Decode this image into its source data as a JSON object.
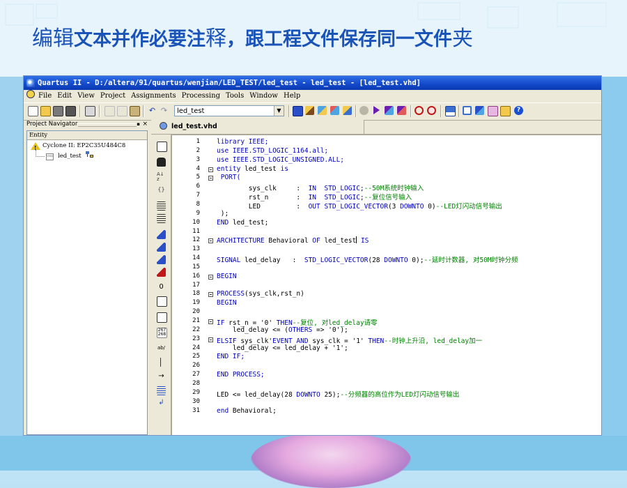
{
  "slide": {
    "title_parts": [
      {
        "text": "编辑",
        "style": "light"
      },
      {
        "text": "文本并作必要注",
        "style": "bold"
      },
      {
        "text": "释",
        "style": "light"
      },
      {
        "text": "，跟工程文件保存同一文件",
        "style": "bold"
      },
      {
        "text": "夹",
        "style": "light"
      }
    ],
    "title_color": "#1a54b8"
  },
  "window": {
    "title": "Quartus II - D:/altera/91/quartus/wenjian/LED_TEST/led_test - led_test - [led_test.vhd]",
    "titlebar_color": "#1248c8"
  },
  "menubar": {
    "items": [
      "File",
      "Edit",
      "View",
      "Project",
      "Assignments",
      "Processing",
      "Tools",
      "Window",
      "Help"
    ]
  },
  "toolbar": {
    "entity_value": "led_test",
    "icons": [
      "new-icon",
      "open-icon",
      "save-icon",
      "save-all-icon",
      "print-icon",
      "cut-icon",
      "copy-icon",
      "paste-icon",
      "undo-icon",
      "redo-icon",
      "pin-planner-icon",
      "assignment-editor-icon",
      "settings-icon",
      "chip-planner-icon",
      "design-partitions-icon",
      "stop-icon",
      "start-compilation-icon",
      "analysis-icon",
      "timing-icon",
      "fitter-icon",
      "timing-analyzer-icon",
      "simulator-icon",
      "programmer-icon",
      "rtl-viewer-icon",
      "chip-editor-icon",
      "help-icon"
    ]
  },
  "navigator": {
    "title": "Project Navigator",
    "column_header": "Entity",
    "device": "Cyclone II: EP2C35U484C8",
    "top_entity": "led_test"
  },
  "editor": {
    "tab_label": "led_test.vhd",
    "side_icons": [
      "insert-template-icon",
      "find-icon",
      "toggle-case-icon",
      "insert-block-icon",
      "indent-icon",
      "unindent-icon",
      "bookmark-toggle-icon",
      "bookmark-next-icon",
      "bookmark-prev-icon",
      "bookmark-clear-icon",
      "attach-icon",
      "template-icon",
      "compile-file-icon",
      "line-number-icon",
      "abc-icon",
      "line-icon",
      "goto-line-icon",
      "list-icon",
      "wrap-icon"
    ],
    "line_numbers": [
      "1",
      "2",
      "3",
      "4",
      "5",
      "6",
      "7",
      "8",
      "9",
      "10",
      "11",
      "12",
      "13",
      "14",
      "15",
      "16",
      "17",
      "18",
      "19",
      "20",
      "21",
      "22",
      "23",
      "24",
      "25",
      "26",
      "27",
      "28",
      "29",
      "30",
      "31"
    ],
    "fold_lines": [
      4,
      5,
      12,
      16,
      18,
      21,
      23
    ],
    "lines": [
      [
        {
          "t": "library IEEE;",
          "c": "kw"
        }
      ],
      [
        {
          "t": "use IEEE.STD_LOGIC_1164.all;",
          "c": "kw"
        }
      ],
      [
        {
          "t": "use IEEE.STD_LOGIC_UNSIGNED.ALL;",
          "c": "kw"
        }
      ],
      [
        {
          "t": "entity ",
          "c": "kw"
        },
        {
          "t": "led_test ",
          "c": ""
        },
        {
          "t": "is",
          "c": "kw"
        }
      ],
      [
        {
          "t": " PORT(",
          "c": "kw"
        }
      ],
      [
        {
          "t": "        sys_clk     :  ",
          "c": ""
        },
        {
          "t": "IN  STD_LOGIC;",
          "c": "kw"
        },
        {
          "t": "--50M系统时钟输入",
          "c": "cm"
        }
      ],
      [
        {
          "t": "        rst_n       :  ",
          "c": ""
        },
        {
          "t": "IN  STD_LOGIC;",
          "c": "kw"
        },
        {
          "t": "--复位信号输入",
          "c": "cm"
        }
      ],
      [
        {
          "t": "        LED         :  ",
          "c": ""
        },
        {
          "t": "OUT STD_LOGIC_VECTOR",
          "c": "kw"
        },
        {
          "t": "(3 ",
          "c": ""
        },
        {
          "t": "DOWNTO",
          "c": "kw"
        },
        {
          "t": " 0)",
          "c": ""
        },
        {
          "t": "--LED灯闪动信号输出",
          "c": "cm"
        }
      ],
      [
        {
          "t": " );",
          "c": ""
        }
      ],
      [
        {
          "t": "END ",
          "c": "kw"
        },
        {
          "t": "led_test;",
          "c": ""
        }
      ],
      [],
      [
        {
          "t": "ARCHITECTURE ",
          "c": "kw"
        },
        {
          "t": "Behavioral ",
          "c": ""
        },
        {
          "t": "OF ",
          "c": "kw"
        },
        {
          "t": "led_test",
          "c": ""
        },
        {
          "t": "|",
          "c": "cursor"
        },
        {
          "t": " IS",
          "c": "kw"
        }
      ],
      [],
      [
        {
          "t": "SIGNAL ",
          "c": "kw"
        },
        {
          "t": "led_delay   :  ",
          "c": ""
        },
        {
          "t": "STD_LOGIC_VECTOR",
          "c": "kw"
        },
        {
          "t": "(28 ",
          "c": ""
        },
        {
          "t": "DOWNTO",
          "c": "kw"
        },
        {
          "t": " 0);",
          "c": ""
        },
        {
          "t": "--延时计数器, 对50M时钟分频",
          "c": "cm"
        }
      ],
      [],
      [
        {
          "t": "BEGIN",
          "c": "kw"
        }
      ],
      [],
      [
        {
          "t": "PROCESS",
          "c": "kw"
        },
        {
          "t": "(sys_clk,rst_n)",
          "c": ""
        }
      ],
      [
        {
          "t": "BEGIN",
          "c": "kw"
        }
      ],
      [],
      [
        {
          "t": "IF ",
          "c": "kw"
        },
        {
          "t": "rst_n = '0' ",
          "c": ""
        },
        {
          "t": "THEN",
          "c": "kw"
        },
        {
          "t": "--复位, 对led_delay请零",
          "c": "cm"
        }
      ],
      [
        {
          "t": "    led_delay <= (",
          "c": ""
        },
        {
          "t": "OTHERS",
          "c": "kw"
        },
        {
          "t": " => '0');",
          "c": ""
        }
      ],
      [
        {
          "t": "ELSIF ",
          "c": "kw"
        },
        {
          "t": "sys_clk'",
          "c": ""
        },
        {
          "t": "EVENT AND ",
          "c": "kw"
        },
        {
          "t": "sys_clk = '1' ",
          "c": ""
        },
        {
          "t": "THEN",
          "c": "kw"
        },
        {
          "t": "--时钟上升沿, led_delay加一",
          "c": "cm"
        }
      ],
      [
        {
          "t": "    led_delay <= led_delay + '1';",
          "c": ""
        }
      ],
      [
        {
          "t": "END IF;",
          "c": "kw"
        }
      ],
      [],
      [
        {
          "t": "END PROCESS;",
          "c": "kw"
        }
      ],
      [],
      [
        {
          "t": "LED <= led_delay(28 ",
          "c": ""
        },
        {
          "t": "DOWNTO",
          "c": "kw"
        },
        {
          "t": " 25);",
          "c": ""
        },
        {
          "t": "--分频器的高位作为LED灯闪动信号输出",
          "c": "cm"
        }
      ],
      [],
      [
        {
          "t": "end ",
          "c": "kw"
        },
        {
          "t": "Behavioral;",
          "c": ""
        }
      ]
    ]
  }
}
